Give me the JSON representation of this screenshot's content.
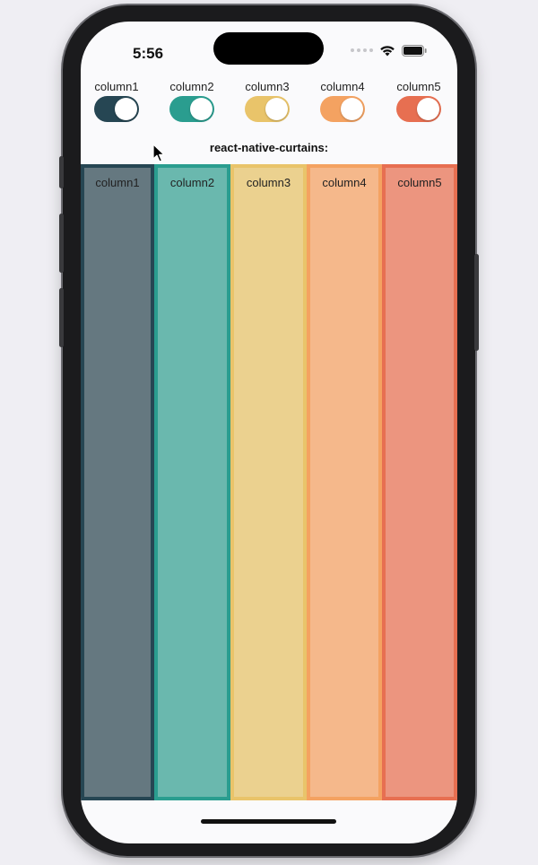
{
  "status_bar": {
    "time": "5:56"
  },
  "toggles": [
    {
      "label": "column1",
      "color": "#264653",
      "on": true
    },
    {
      "label": "column2",
      "color": "#2a9d8f",
      "on": true
    },
    {
      "label": "column3",
      "color": "#e9c46a",
      "on": true
    },
    {
      "label": "column4",
      "color": "#f4a261",
      "on": true
    },
    {
      "label": "column5",
      "color": "#e76f51",
      "on": true
    }
  ],
  "heading": "react-native-curtains:",
  "columns": [
    {
      "label": "column1",
      "border": "#264653",
      "fill": "#657880"
    },
    {
      "label": "column2",
      "border": "#2a9d8f",
      "fill": "#6ab8ae"
    },
    {
      "label": "column3",
      "border": "#e9c46a",
      "fill": "#ebd18f"
    },
    {
      "label": "column4",
      "border": "#f4a261",
      "fill": "#f5b88b"
    },
    {
      "label": "column5",
      "border": "#e76f51",
      "fill": "#ec957f"
    }
  ]
}
